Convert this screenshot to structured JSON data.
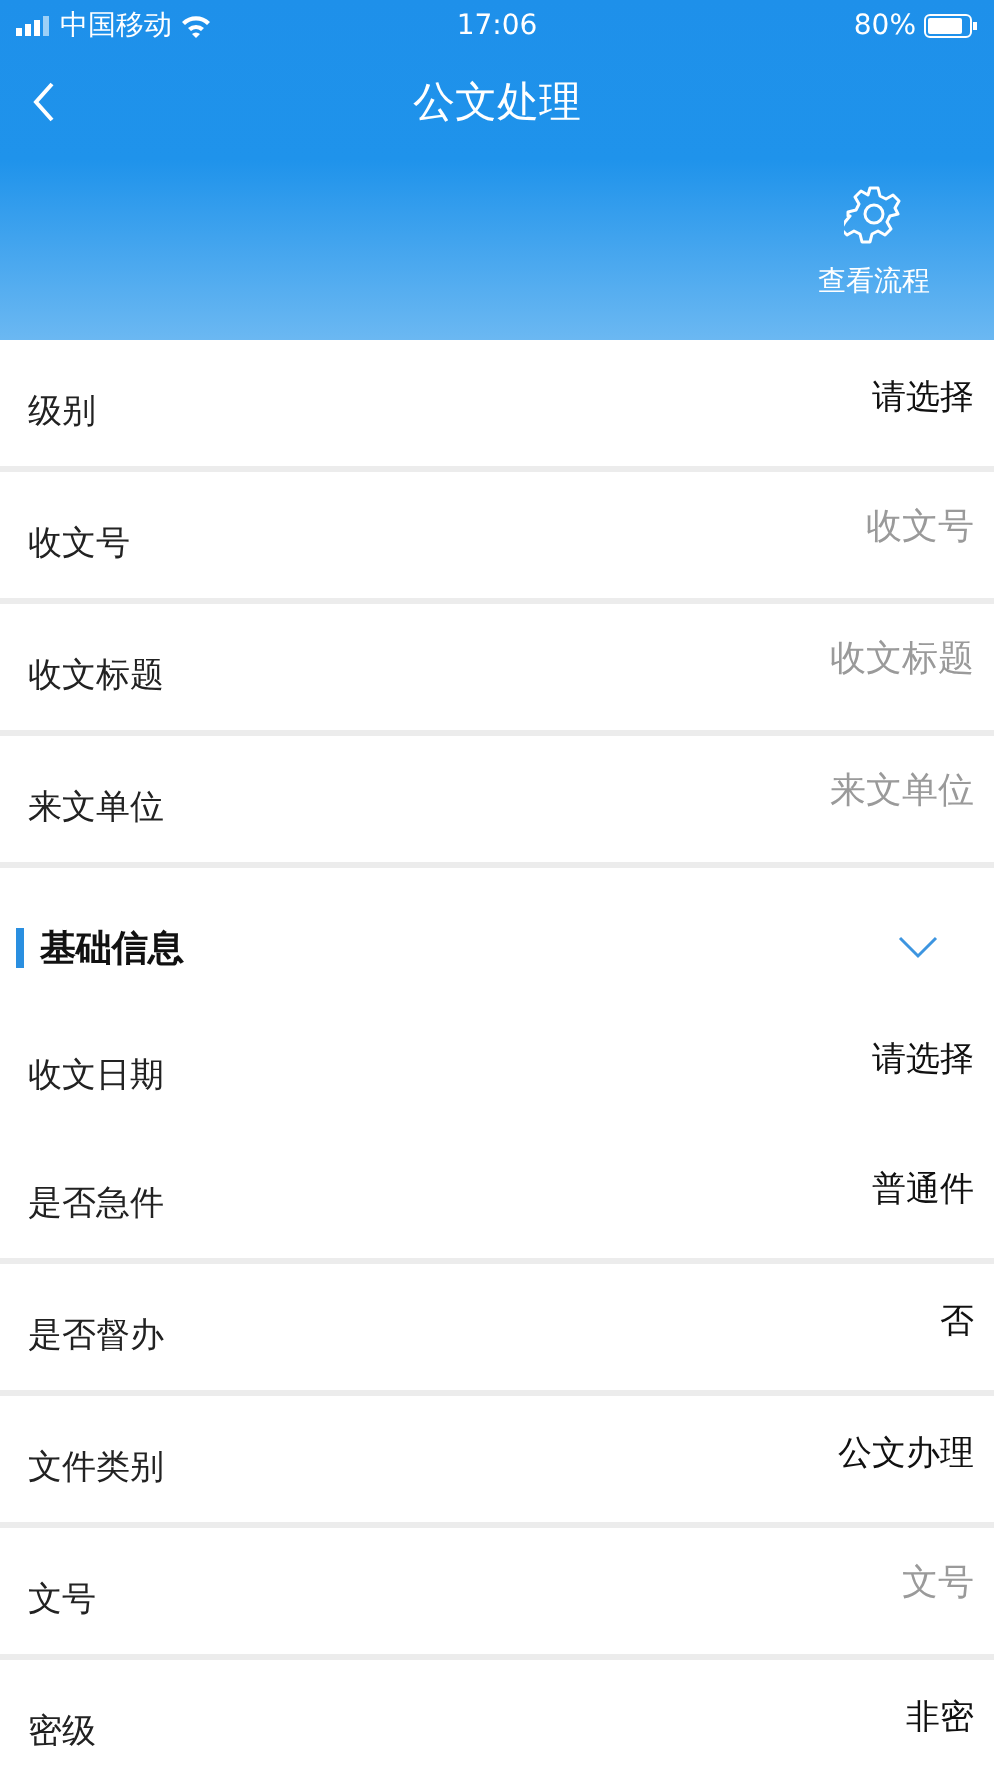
{
  "status_bar": {
    "carrier": "中国移动",
    "time": "17:06",
    "battery": "80%"
  },
  "nav": {
    "title": "公文处理",
    "action": "查看流程"
  },
  "fields": [
    {
      "label": "级别",
      "kind": "select",
      "value": "请选择"
    },
    {
      "label": "收文号",
      "kind": "input",
      "placeholder": "收文号"
    },
    {
      "label": "收文标题",
      "kind": "input",
      "placeholder": "收文标题"
    },
    {
      "label": "来文单位",
      "kind": "input",
      "placeholder": "来文单位"
    }
  ],
  "section": {
    "title": "基础信息",
    "expanded": true,
    "fields": [
      {
        "label": "收文日期",
        "kind": "select",
        "value": "请选择"
      },
      {
        "label": "是否急件",
        "kind": "select",
        "value": "普通件"
      },
      {
        "label": "是否督办",
        "kind": "select",
        "value": "否"
      },
      {
        "label": "文件类别",
        "kind": "select",
        "value": "公文办理"
      },
      {
        "label": "文号",
        "kind": "input",
        "placeholder": "文号"
      },
      {
        "label": "密级",
        "kind": "select",
        "value": "非密"
      }
    ]
  }
}
